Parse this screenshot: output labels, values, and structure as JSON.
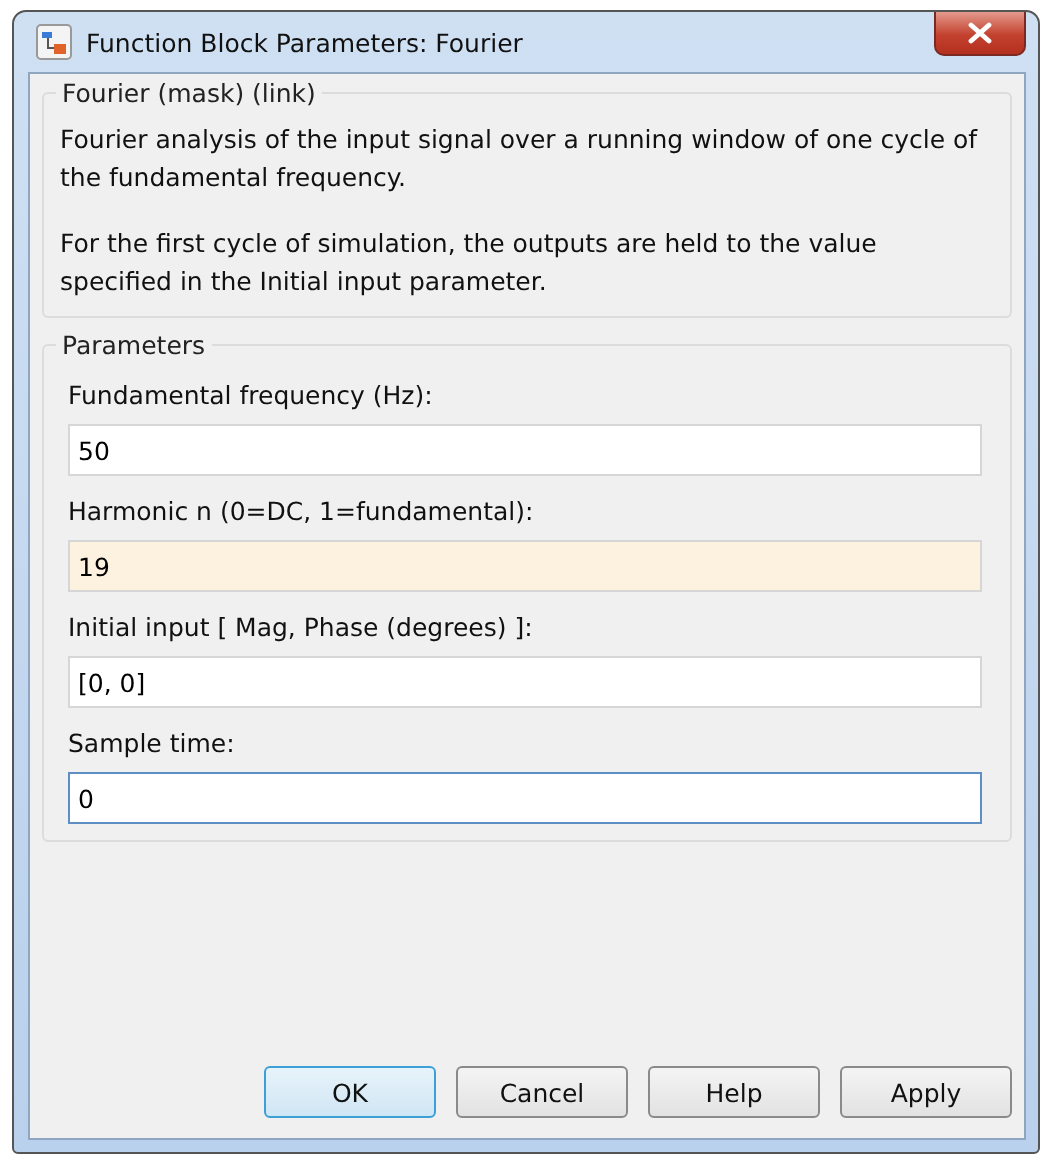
{
  "window": {
    "title": "Function Block Parameters: Fourier"
  },
  "description": {
    "title": "Fourier (mask) (link)",
    "paragraphs": [
      "Fourier analysis of the input signal over a running window of one cycle of the fundamental frequency.",
      "For the first cycle of simulation, the outputs are held  to the value specified in the Initial input parameter."
    ]
  },
  "parameters": {
    "title": "Parameters",
    "fields": [
      {
        "label": "Fundamental frequency (Hz):",
        "value": "50",
        "modified": false,
        "focused": false
      },
      {
        "label": "Harmonic n (0=DC, 1=fundamental):",
        "value": "19",
        "modified": true,
        "focused": false
      },
      {
        "label": "Initial input [ Mag, Phase (degrees) ]:",
        "value": "[0, 0]",
        "modified": false,
        "focused": false
      },
      {
        "label": "Sample time:",
        "value": "0",
        "modified": false,
        "focused": true
      }
    ]
  },
  "buttons": [
    {
      "label": "OK",
      "default": true
    },
    {
      "label": "Cancel",
      "default": false
    },
    {
      "label": "Help",
      "default": false
    },
    {
      "label": "Apply",
      "default": false
    }
  ]
}
